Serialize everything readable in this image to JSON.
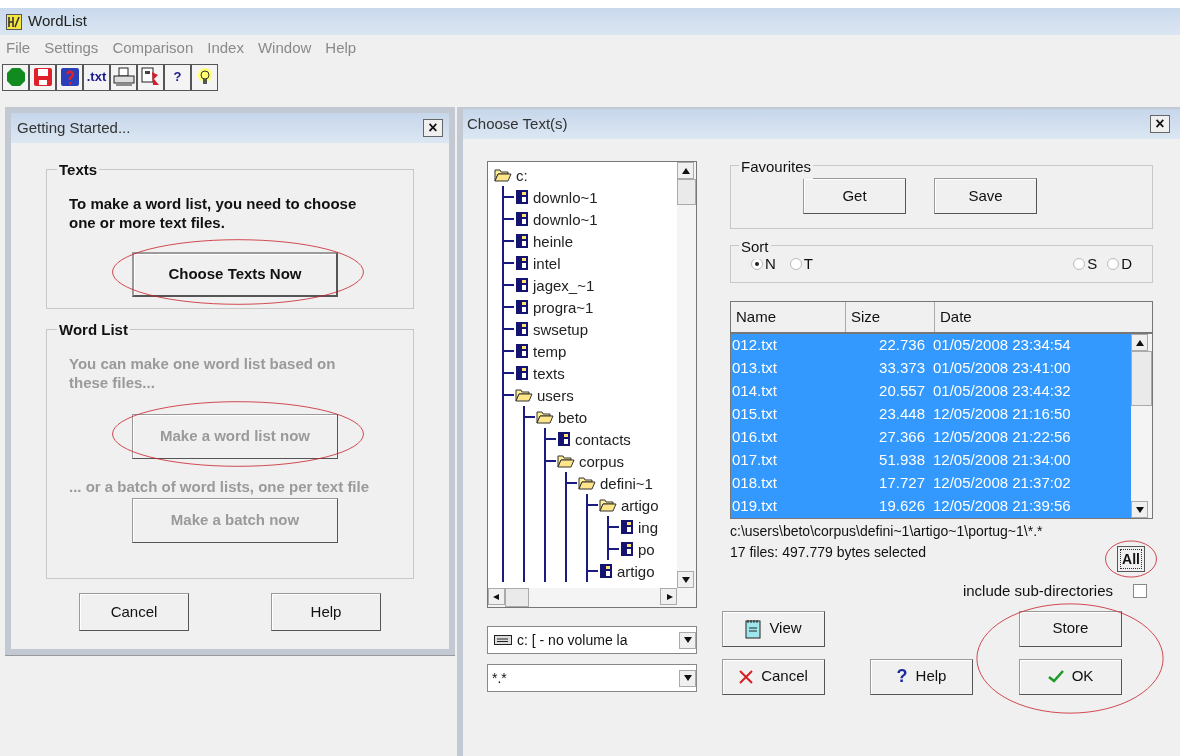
{
  "window": {
    "title": "WordList"
  },
  "menu": [
    {
      "label": "File",
      "disabled": true
    },
    {
      "label": "Settings",
      "disabled": true
    },
    {
      "label": "Comparison",
      "disabled": true
    },
    {
      "label": "Index",
      "disabled": true
    },
    {
      "label": "Window",
      "disabled": true
    },
    {
      "label": "Help",
      "disabled": true
    }
  ],
  "toolbar": [
    {
      "kind": "stop"
    },
    {
      "kind": "save"
    },
    {
      "kind": "help-save"
    },
    {
      "kind": "text",
      "label": ".txt"
    },
    {
      "kind": "print"
    },
    {
      "kind": "print-setup"
    },
    {
      "kind": "text",
      "label": "?"
    },
    {
      "kind": "tip"
    }
  ],
  "getting_started": {
    "title": "Getting Started...",
    "close": "×",
    "texts_group": {
      "title": "Texts",
      "text": "To make a word list, you need to choose one or more text files.",
      "text_disabled": false,
      "button": {
        "label": "Choose Texts Now",
        "disabled": false,
        "circled": true
      }
    },
    "word_list_group": {
      "title": "Word List",
      "text": "You can make one word list based on these files...",
      "text_disabled": true,
      "button": {
        "label": "Make a word list now",
        "disabled": true,
        "circled": true
      },
      "text_2": "... or a batch of word lists, one per text file",
      "button_2": {
        "label": "Make a batch now",
        "disabled": true,
        "circled": false
      }
    },
    "buttons": [
      {
        "label": "Cancel"
      },
      {
        "label": "Help"
      }
    ]
  },
  "choose_texts": {
    "title": "Choose Text(s)",
    "close": "×",
    "tree": [
      {
        "label": "c:",
        "expanded": true,
        "children": [
          {
            "label": "downlo~1",
            "expanded": false
          },
          {
            "label": "downlo~1",
            "expanded": false
          },
          {
            "label": "heinle",
            "expanded": false
          },
          {
            "label": "intel",
            "expanded": false
          },
          {
            "label": "jagex_~1",
            "expanded": false
          },
          {
            "label": "progra~1",
            "expanded": false
          },
          {
            "label": "swsetup",
            "expanded": false
          },
          {
            "label": "temp",
            "expanded": false
          },
          {
            "label": "texts",
            "expanded": false
          },
          {
            "label": "users",
            "expanded": true,
            "children": [
              {
                "label": "beto",
                "expanded": true,
                "children": [
                  {
                    "label": "contacts",
                    "expanded": false
                  },
                  {
                    "label": "corpus",
                    "expanded": true,
                    "children": [
                      {
                        "label": "defini~1",
                        "expanded": true,
                        "children": [
                          {
                            "label": "artigo",
                            "expanded": true,
                            "children": [
                              {
                                "label": "ing",
                                "expanded": false
                              },
                              {
                                "label": "po",
                                "expanded": false
                              }
                            ]
                          },
                          {
                            "label": "artigo",
                            "expanded": false
                          }
                        ]
                      }
                    ]
                  }
                ]
              }
            ]
          }
        ]
      }
    ],
    "drive": {
      "value": "c: [ - no volume la"
    },
    "filter": {
      "value": "*.*"
    },
    "favourites": {
      "title": "Favourites",
      "buttons": [
        {
          "label": "Get"
        },
        {
          "label": "Save"
        }
      ]
    },
    "sort": {
      "title": "Sort",
      "options": [
        {
          "label": "N",
          "selected": true
        },
        {
          "label": "T",
          "selected": false
        },
        {
          "label": "S",
          "selected": false
        },
        {
          "label": "D",
          "selected": false
        }
      ]
    },
    "files": {
      "columns": [
        "Name",
        "Size",
        "Date"
      ],
      "rows": [
        {
          "name": "012.txt",
          "size": "22.736",
          "date": "01/05/2008 23:34:54",
          "selected": true
        },
        {
          "name": "013.txt",
          "size": "33.373",
          "date": "01/05/2008 23:41:00",
          "selected": true
        },
        {
          "name": "014.txt",
          "size": "20.557",
          "date": "01/05/2008 23:44:32",
          "selected": true
        },
        {
          "name": "015.txt",
          "size": "23.448",
          "date": "12/05/2008 21:16:50",
          "selected": true
        },
        {
          "name": "016.txt",
          "size": "27.366",
          "date": "12/05/2008 21:22:56",
          "selected": true
        },
        {
          "name": "017.txt",
          "size": "51.938",
          "date": "12/05/2008 21:34:00",
          "selected": true
        },
        {
          "name": "018.txt",
          "size": "17.727",
          "date": "12/05/2008 21:37:02",
          "selected": true
        },
        {
          "name": "019.txt",
          "size": "19.626",
          "date": "12/05/2008 21:39:56",
          "selected": true
        }
      ]
    },
    "path": "c:\\users\\beto\\corpus\\defini~1\\artigo~1\\portug~1\\*.*",
    "summary": "17 files: 497.779 bytes selected",
    "all_button": {
      "label": "All",
      "circled": true
    },
    "include_subdirs": {
      "label": "include sub-directories",
      "checked": false
    },
    "view_button": {
      "label": "View"
    },
    "cancel_button": {
      "label": "Cancel"
    },
    "help_button": {
      "label": "Help",
      "icon": "?"
    },
    "store_ok": {
      "circled": true,
      "buttons": [
        {
          "kind": "store",
          "label": "Store"
        },
        {
          "kind": "ok",
          "label": "OK"
        }
      ]
    }
  }
}
